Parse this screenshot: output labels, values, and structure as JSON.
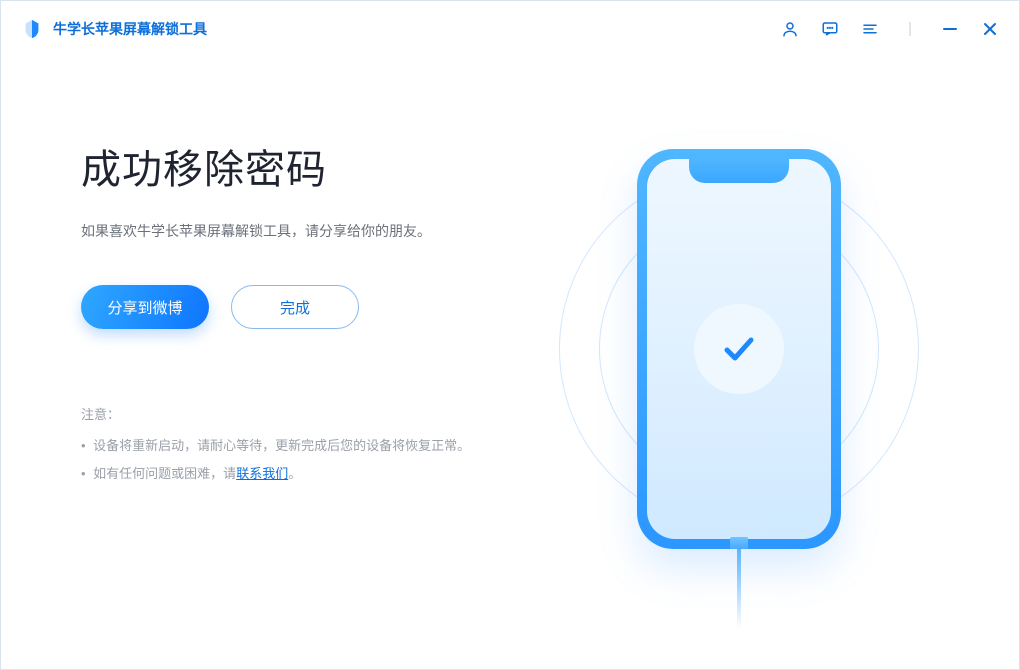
{
  "titlebar": {
    "app_name": "牛学长苹果屏幕解锁工具"
  },
  "main": {
    "heading": "成功移除密码",
    "subheading": "如果喜欢牛学长苹果屏幕解锁工具，请分享给你的朋友。",
    "share_button": "分享到微博",
    "done_button": "完成"
  },
  "notes": {
    "title": "注意：",
    "items": [
      "设备将重新启动，请耐心等待，更新完成后您的设备将恢复正常。"
    ],
    "line3_prefix": "如有任何问题或困难，请",
    "contact_link": "联系我们",
    "line3_suffix": "。"
  }
}
